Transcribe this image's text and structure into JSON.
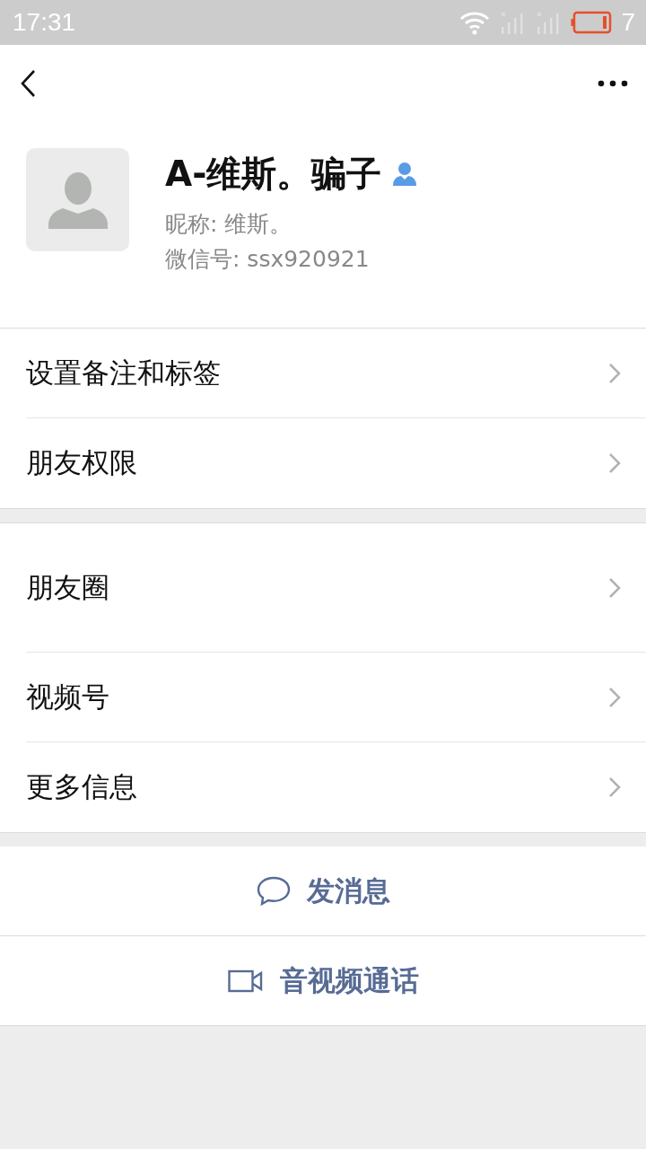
{
  "status_bar": {
    "time": "17:31",
    "battery_text": "7"
  },
  "profile": {
    "name": "A-维斯。骗子",
    "nickname": "昵称:  维斯。",
    "wechat_id": "微信号:  ssx920921"
  },
  "groups": [
    {
      "rows": [
        {
          "label": "设置备注和标签",
          "kind": "normal"
        },
        {
          "label": "朋友权限",
          "kind": "normal"
        }
      ]
    },
    {
      "rows": [
        {
          "label": "朋友圈",
          "kind": "tall"
        },
        {
          "label": "视频号",
          "kind": "normal"
        },
        {
          "label": "更多信息",
          "kind": "normal"
        }
      ]
    }
  ],
  "actions": [
    {
      "label": "发消息",
      "kind": "message"
    },
    {
      "label": "音视频通话",
      "kind": "call"
    }
  ]
}
